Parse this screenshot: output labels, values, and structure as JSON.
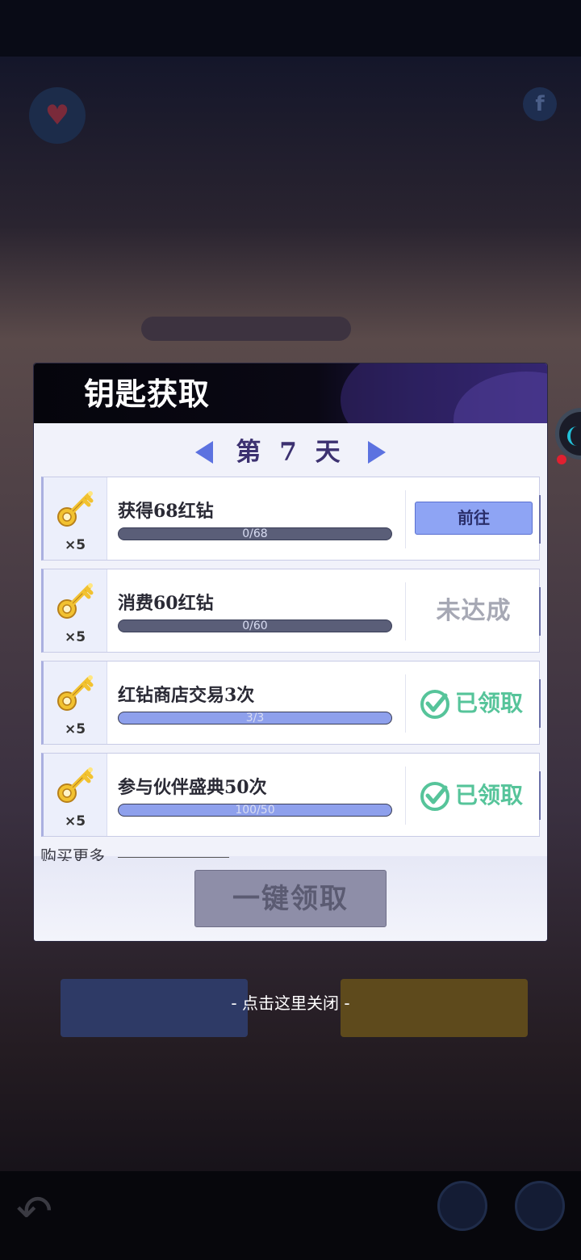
{
  "dialog": {
    "title": "钥匙获取",
    "day_label": "第 7 天",
    "tasks": [
      {
        "title": "获得68红钻",
        "progress_text": "0/68",
        "progress_fraction": 0,
        "reward_count": "×5",
        "action_type": "goto",
        "action_label": "前往"
      },
      {
        "title": "消费60红钻",
        "progress_text": "0/60",
        "progress_fraction": 0,
        "reward_count": "×5",
        "action_type": "not_reached",
        "action_label": "未达成"
      },
      {
        "title": "红钻商店交易3次",
        "progress_text": "3/3",
        "progress_fraction": 1,
        "reward_count": "×5",
        "action_type": "claimed",
        "action_label": "已领取"
      },
      {
        "title": "参与伙伴盛典50次",
        "progress_text": "100/50",
        "progress_fraction": 1,
        "reward_count": "×5",
        "action_type": "claimed",
        "action_label": "已领取"
      }
    ],
    "buy_more": "购买更多",
    "claim_all_label": "一键领取"
  },
  "close_hint": "- 点击这里关闭 -",
  "colors": {
    "accent_blue": "#8ea4f4",
    "claimed_green": "#56c49a",
    "title_purple": "#3c3170",
    "key_gold": "#f2c230"
  },
  "icons": {
    "reward": "key-icon",
    "claimed": "check-circle-icon",
    "day_prev": "triangle-left-icon",
    "day_next": "triangle-right-icon"
  }
}
